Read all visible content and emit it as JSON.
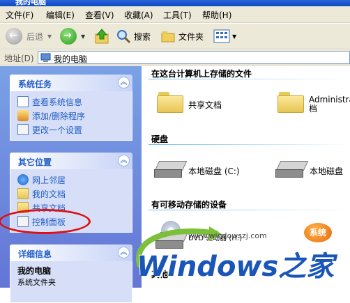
{
  "window": {
    "title": "我的电脑"
  },
  "menu": [
    "文件(F)",
    "编辑(E)",
    "查看(V)",
    "收藏(A)",
    "工具(T)",
    "帮助(H)"
  ],
  "toolbar": {
    "back": "后退",
    "search": "搜索",
    "folders": "文件夹"
  },
  "address": {
    "label": "地址(D)",
    "value": "我的电脑"
  },
  "tasks": {
    "title": "系统任务",
    "items": [
      "查看系统信息",
      "添加/删除程序",
      "更改一个设置"
    ]
  },
  "places": {
    "title": "其它位置",
    "items": [
      "网上邻居",
      "我的文档",
      "共享文档",
      "控制面板"
    ]
  },
  "details": {
    "title": "详细信息",
    "name": "我的电脑",
    "type": "系统文件夹"
  },
  "content": {
    "files_section": "在这台计算机上存储的文件",
    "files": [
      "共享文档",
      "Administra\n档"
    ],
    "hdd_section": "硬盘",
    "drives": [
      "本地磁盘 (C:)",
      "本地磁盘"
    ],
    "removable_section": "有可移动存储的设备",
    "removable": [
      "DVD 驱动器 (H:)"
    ],
    "other_section": "其他"
  },
  "watermark": {
    "url": "www.windowszj.com",
    "brand": "Windows之家",
    "badge": "系统"
  }
}
